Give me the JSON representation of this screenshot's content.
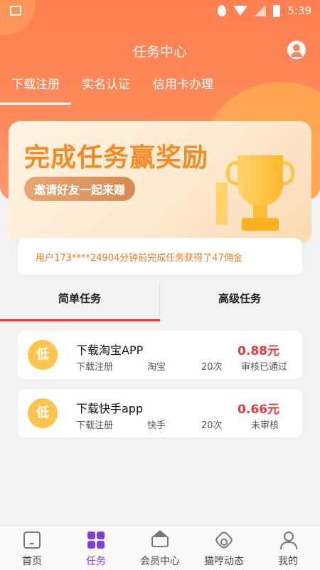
{
  "status_bar": {
    "time": "5:39",
    "icons": [
      "image-icon",
      "location-icon",
      "wifi-icon",
      "no-sim-icon",
      "battery-charging-icon"
    ]
  },
  "header": {
    "title": "任务中心",
    "user_icon": "user-circle-icon"
  },
  "category_tabs": [
    {
      "label": "下载注册",
      "active": true
    },
    {
      "label": "实名认证",
      "active": false
    },
    {
      "label": "信用卡办理",
      "active": false
    }
  ],
  "banner": {
    "title": "完成任务赢奖励",
    "subtitle": "邀请好友一起来赚"
  },
  "notice": {
    "text": "用户173****24904分钟前完成任务获得了47佣金"
  },
  "task_tabs": [
    {
      "label": "简单任务",
      "active": true
    },
    {
      "label": "高级任务",
      "active": false
    }
  ],
  "tasks": [
    {
      "badge": "低",
      "name": "下载淘宝APP",
      "type": "下载注册",
      "platform": "淘宝",
      "count": "20次",
      "price": "0.88元",
      "status": "审核已通过"
    },
    {
      "badge": "低",
      "name": "下载快手app",
      "type": "下载注册",
      "platform": "快手",
      "count": "20次",
      "price": "0.66元",
      "status": "未审核"
    }
  ],
  "bottom_nav": [
    {
      "label": "首页",
      "icon": "home-icon",
      "active": false
    },
    {
      "label": "任务",
      "icon": "grid-icon",
      "active": true
    },
    {
      "label": "会员中心",
      "icon": "crown-icon",
      "active": false
    },
    {
      "label": "猫哼动态",
      "icon": "hexagon-icon",
      "active": false
    },
    {
      "label": "我的",
      "icon": "person-icon",
      "active": false
    }
  ],
  "colors": {
    "header": "#ff7f50",
    "accent_red": "#e83a3a",
    "notice_orange": "#f57a1f",
    "badge_yellow": "#ffc44d",
    "nav_active": "#7b3fe4"
  }
}
